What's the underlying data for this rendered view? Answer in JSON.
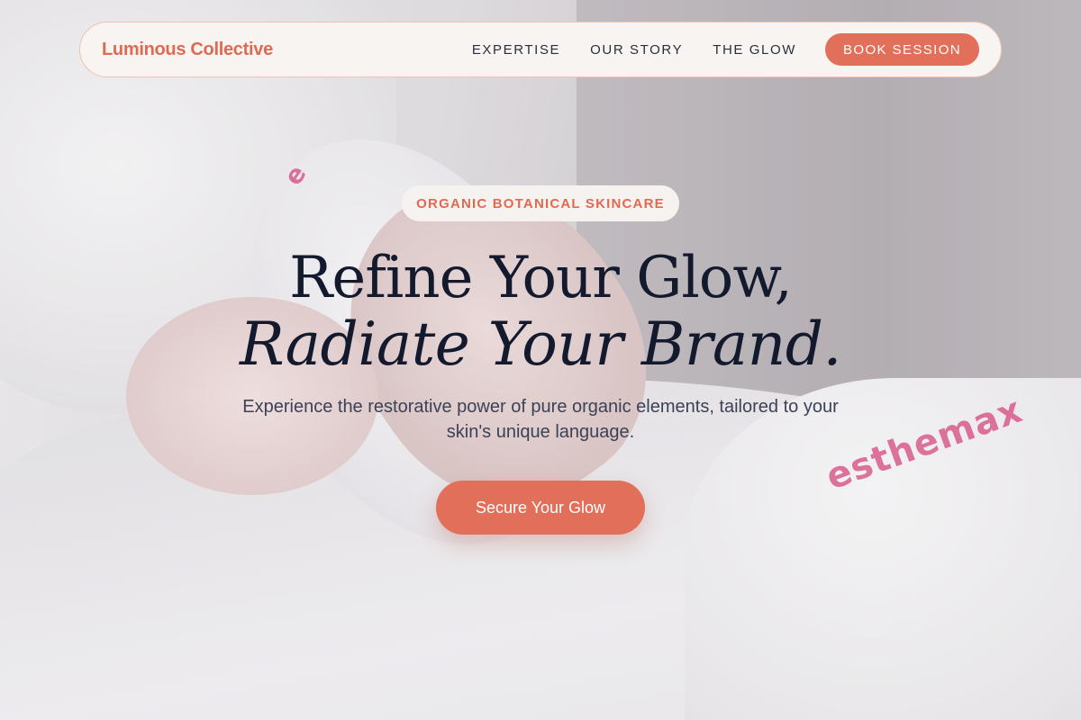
{
  "nav": {
    "brand": "Luminous Collective",
    "links": [
      "EXPERTISE",
      "OUR STORY",
      "THE GLOW"
    ],
    "cta_label": "BOOK SESSION"
  },
  "hero": {
    "badge": "ORGANIC BOTANICAL SKINCARE",
    "headline_line1": "Refine Your Glow,",
    "headline_line2": "Radiate Your Brand.",
    "subtext": "Experience the restorative power of pure organic elements, tailored to your skin's unique language.",
    "cta_label": "Secure Your Glow",
    "background_marks": {
      "robe": "esthemax",
      "headband": "e"
    }
  },
  "colors": {
    "accent": "#e26f59",
    "brand_text": "#de6a52",
    "heading": "#141a2e",
    "body_text": "#3c4256",
    "nav_background": "#f8f4f1"
  }
}
